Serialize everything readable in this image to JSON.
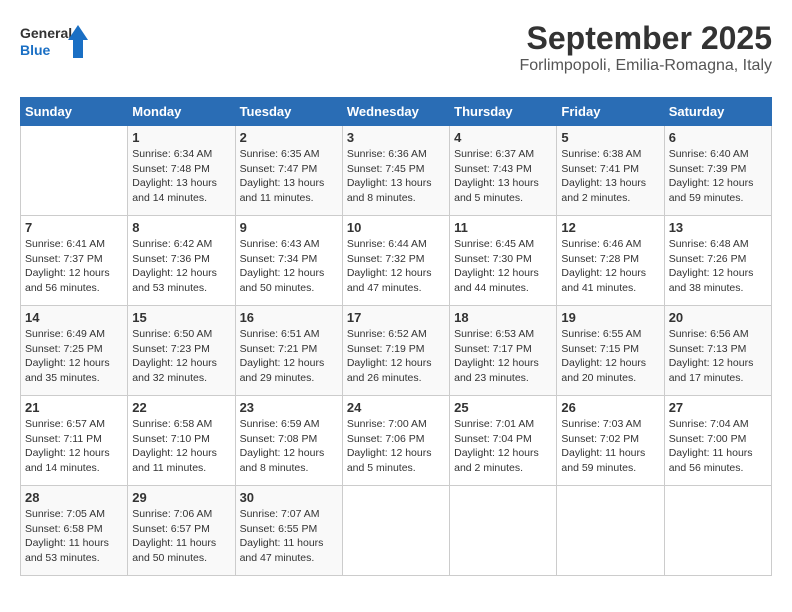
{
  "header": {
    "logo_line1": "General",
    "logo_line2": "Blue",
    "month": "September 2025",
    "location": "Forlimpopoli, Emilia-Romagna, Italy"
  },
  "weekdays": [
    "Sunday",
    "Monday",
    "Tuesday",
    "Wednesday",
    "Thursday",
    "Friday",
    "Saturday"
  ],
  "weeks": [
    [
      {
        "day": "",
        "empty": true
      },
      {
        "day": "1",
        "sunrise": "Sunrise: 6:34 AM",
        "sunset": "Sunset: 7:48 PM",
        "daylight": "Daylight: 13 hours and 14 minutes."
      },
      {
        "day": "2",
        "sunrise": "Sunrise: 6:35 AM",
        "sunset": "Sunset: 7:47 PM",
        "daylight": "Daylight: 13 hours and 11 minutes."
      },
      {
        "day": "3",
        "sunrise": "Sunrise: 6:36 AM",
        "sunset": "Sunset: 7:45 PM",
        "daylight": "Daylight: 13 hours and 8 minutes."
      },
      {
        "day": "4",
        "sunrise": "Sunrise: 6:37 AM",
        "sunset": "Sunset: 7:43 PM",
        "daylight": "Daylight: 13 hours and 5 minutes."
      },
      {
        "day": "5",
        "sunrise": "Sunrise: 6:38 AM",
        "sunset": "Sunset: 7:41 PM",
        "daylight": "Daylight: 13 hours and 2 minutes."
      },
      {
        "day": "6",
        "sunrise": "Sunrise: 6:40 AM",
        "sunset": "Sunset: 7:39 PM",
        "daylight": "Daylight: 12 hours and 59 minutes."
      }
    ],
    [
      {
        "day": "7",
        "sunrise": "Sunrise: 6:41 AM",
        "sunset": "Sunset: 7:37 PM",
        "daylight": "Daylight: 12 hours and 56 minutes."
      },
      {
        "day": "8",
        "sunrise": "Sunrise: 6:42 AM",
        "sunset": "Sunset: 7:36 PM",
        "daylight": "Daylight: 12 hours and 53 minutes."
      },
      {
        "day": "9",
        "sunrise": "Sunrise: 6:43 AM",
        "sunset": "Sunset: 7:34 PM",
        "daylight": "Daylight: 12 hours and 50 minutes."
      },
      {
        "day": "10",
        "sunrise": "Sunrise: 6:44 AM",
        "sunset": "Sunset: 7:32 PM",
        "daylight": "Daylight: 12 hours and 47 minutes."
      },
      {
        "day": "11",
        "sunrise": "Sunrise: 6:45 AM",
        "sunset": "Sunset: 7:30 PM",
        "daylight": "Daylight: 12 hours and 44 minutes."
      },
      {
        "day": "12",
        "sunrise": "Sunrise: 6:46 AM",
        "sunset": "Sunset: 7:28 PM",
        "daylight": "Daylight: 12 hours and 41 minutes."
      },
      {
        "day": "13",
        "sunrise": "Sunrise: 6:48 AM",
        "sunset": "Sunset: 7:26 PM",
        "daylight": "Daylight: 12 hours and 38 minutes."
      }
    ],
    [
      {
        "day": "14",
        "sunrise": "Sunrise: 6:49 AM",
        "sunset": "Sunset: 7:25 PM",
        "daylight": "Daylight: 12 hours and 35 minutes."
      },
      {
        "day": "15",
        "sunrise": "Sunrise: 6:50 AM",
        "sunset": "Sunset: 7:23 PM",
        "daylight": "Daylight: 12 hours and 32 minutes."
      },
      {
        "day": "16",
        "sunrise": "Sunrise: 6:51 AM",
        "sunset": "Sunset: 7:21 PM",
        "daylight": "Daylight: 12 hours and 29 minutes."
      },
      {
        "day": "17",
        "sunrise": "Sunrise: 6:52 AM",
        "sunset": "Sunset: 7:19 PM",
        "daylight": "Daylight: 12 hours and 26 minutes."
      },
      {
        "day": "18",
        "sunrise": "Sunrise: 6:53 AM",
        "sunset": "Sunset: 7:17 PM",
        "daylight": "Daylight: 12 hours and 23 minutes."
      },
      {
        "day": "19",
        "sunrise": "Sunrise: 6:55 AM",
        "sunset": "Sunset: 7:15 PM",
        "daylight": "Daylight: 12 hours and 20 minutes."
      },
      {
        "day": "20",
        "sunrise": "Sunrise: 6:56 AM",
        "sunset": "Sunset: 7:13 PM",
        "daylight": "Daylight: 12 hours and 17 minutes."
      }
    ],
    [
      {
        "day": "21",
        "sunrise": "Sunrise: 6:57 AM",
        "sunset": "Sunset: 7:11 PM",
        "daylight": "Daylight: 12 hours and 14 minutes."
      },
      {
        "day": "22",
        "sunrise": "Sunrise: 6:58 AM",
        "sunset": "Sunset: 7:10 PM",
        "daylight": "Daylight: 12 hours and 11 minutes."
      },
      {
        "day": "23",
        "sunrise": "Sunrise: 6:59 AM",
        "sunset": "Sunset: 7:08 PM",
        "daylight": "Daylight: 12 hours and 8 minutes."
      },
      {
        "day": "24",
        "sunrise": "Sunrise: 7:00 AM",
        "sunset": "Sunset: 7:06 PM",
        "daylight": "Daylight: 12 hours and 5 minutes."
      },
      {
        "day": "25",
        "sunrise": "Sunrise: 7:01 AM",
        "sunset": "Sunset: 7:04 PM",
        "daylight": "Daylight: 12 hours and 2 minutes."
      },
      {
        "day": "26",
        "sunrise": "Sunrise: 7:03 AM",
        "sunset": "Sunset: 7:02 PM",
        "daylight": "Daylight: 11 hours and 59 minutes."
      },
      {
        "day": "27",
        "sunrise": "Sunrise: 7:04 AM",
        "sunset": "Sunset: 7:00 PM",
        "daylight": "Daylight: 11 hours and 56 minutes."
      }
    ],
    [
      {
        "day": "28",
        "sunrise": "Sunrise: 7:05 AM",
        "sunset": "Sunset: 6:58 PM",
        "daylight": "Daylight: 11 hours and 53 minutes."
      },
      {
        "day": "29",
        "sunrise": "Sunrise: 7:06 AM",
        "sunset": "Sunset: 6:57 PM",
        "daylight": "Daylight: 11 hours and 50 minutes."
      },
      {
        "day": "30",
        "sunrise": "Sunrise: 7:07 AM",
        "sunset": "Sunset: 6:55 PM",
        "daylight": "Daylight: 11 hours and 47 minutes."
      },
      {
        "day": "",
        "empty": true
      },
      {
        "day": "",
        "empty": true
      },
      {
        "day": "",
        "empty": true
      },
      {
        "day": "",
        "empty": true
      }
    ]
  ]
}
